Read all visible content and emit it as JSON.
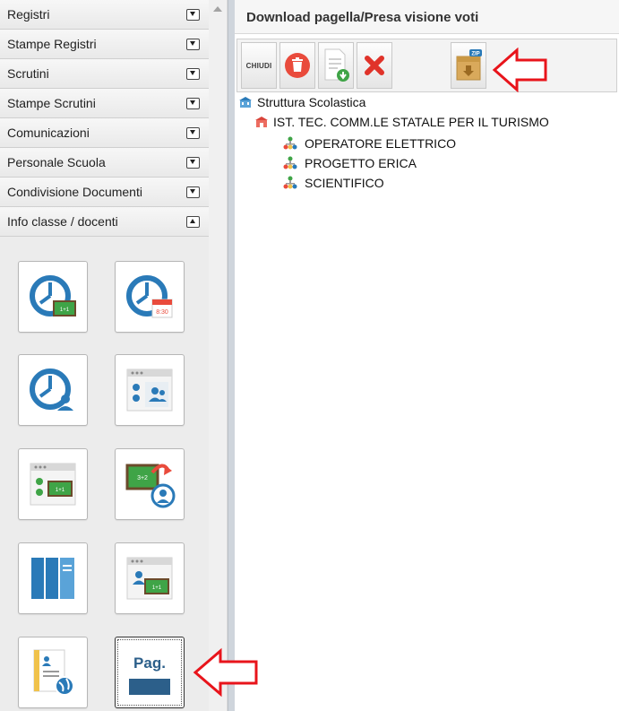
{
  "sidebar": {
    "sections": [
      {
        "label": "Registri",
        "expanded": false
      },
      {
        "label": "Stampe Registri",
        "expanded": false
      },
      {
        "label": "Scrutini",
        "expanded": false
      },
      {
        "label": "Stampe Scrutini",
        "expanded": false
      },
      {
        "label": "Comunicazioni",
        "expanded": false
      },
      {
        "label": "Personale Scuola",
        "expanded": false
      },
      {
        "label": "Condivisione Documenti",
        "expanded": false
      },
      {
        "label": "Info classe / docenti",
        "expanded": true
      }
    ],
    "tiles": [
      {
        "icon": "clock-classroom-icon"
      },
      {
        "icon": "clock-calendar-icon"
      },
      {
        "icon": "clock-teacher-icon"
      },
      {
        "icon": "students-teacher-window-icon"
      },
      {
        "icon": "students-board-window-icon"
      },
      {
        "icon": "board-share-icon"
      },
      {
        "icon": "registers-books-icon"
      },
      {
        "icon": "teacher-board-window-icon"
      },
      {
        "icon": "document-globe-icon"
      },
      {
        "icon": "report-card-icon",
        "text": "Pag.",
        "selected": true
      }
    ]
  },
  "main": {
    "title": "Download pagella/Presa visione voti",
    "toolbar": {
      "close_label": "CHIUDI",
      "buttons": [
        "chiudi-button",
        "trash-icon",
        "document-download-icon",
        "delete-x-icon",
        "zip-archive-icon"
      ]
    },
    "tree": {
      "root": "Struttura Scolastica",
      "school": "IST. TEC. COMM.LE STATALE PER IL TURISMO",
      "courses": [
        "OPERATORE ELETTRICO",
        "PROGETTO ERICA",
        "SCIENTIFICO"
      ]
    }
  },
  "colors": {
    "annotation_arrow": "#e8141b",
    "icon_blue": "#2a7ab8",
    "icon_green": "#3fa447",
    "trash_red": "#e94b3c",
    "x_red": "#e0332a",
    "tree_red": "#d9443a"
  }
}
